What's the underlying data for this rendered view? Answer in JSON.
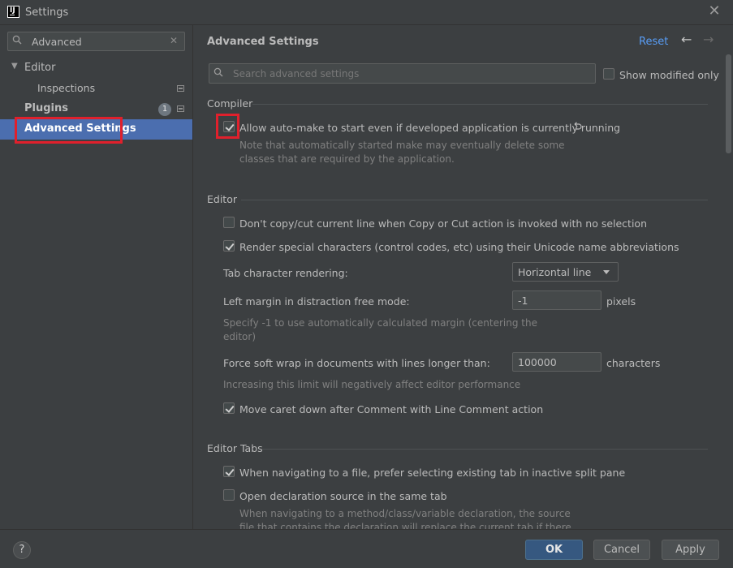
{
  "window": {
    "title": "Settings",
    "close_glyph": "✕"
  },
  "sidebar": {
    "search_value": "Advanced",
    "items": [
      {
        "label": "Editor",
        "expanded": true
      },
      {
        "label": "Inspections"
      },
      {
        "label": "Plugins",
        "badge": "1"
      },
      {
        "label": "Advanced Settings",
        "selected": true
      }
    ]
  },
  "header": {
    "title": "Advanced Settings",
    "reset": "Reset",
    "back_glyph": "←",
    "forward_glyph": "→"
  },
  "search": {
    "placeholder": "Search advanced settings",
    "show_modified_label": "Show modified only",
    "show_modified_checked": false
  },
  "compiler": {
    "section": "Compiler",
    "auto_make_label": "Allow auto-make to start even if developed application is currently running",
    "auto_make_checked": true,
    "auto_make_note_1": "Note that automatically started make may eventually delete some",
    "auto_make_note_2": "classes that are required by the application."
  },
  "editor": {
    "section": "Editor",
    "dont_copy_label": "Don't copy/cut current line when Copy or Cut action is invoked with no selection",
    "dont_copy_checked": false,
    "render_special_label": "Render special characters (control codes, etc) using their Unicode name abbreviations",
    "render_special_checked": true,
    "tab_rendering_label": "Tab character rendering:",
    "tab_rendering_value": "Horizontal line",
    "left_margin_label": "Left margin in distraction free mode:",
    "left_margin_value": "-1",
    "left_margin_unit": "pixels",
    "left_margin_note_1": "Specify -1 to use automatically calculated margin (centering the",
    "left_margin_note_2": "editor)",
    "soft_wrap_label": "Force soft wrap in documents with lines longer than:",
    "soft_wrap_value": "100000",
    "soft_wrap_unit": "characters",
    "soft_wrap_note": "Increasing this limit will negatively affect editor performance",
    "move_caret_label": "Move caret down after Comment with Line Comment action",
    "move_caret_checked": true
  },
  "editor_tabs": {
    "section": "Editor Tabs",
    "prefer_existing_label": "When navigating to a file, prefer selecting existing tab in inactive split pane",
    "prefer_existing_checked": true,
    "open_same_tab_label": "Open declaration source in the same tab",
    "open_same_tab_checked": false,
    "open_same_tab_note_1": "When navigating to a method/class/variable declaration, the source",
    "open_same_tab_note_2": "file that contains the declaration will replace the current tab if there"
  },
  "footer": {
    "help": "?",
    "ok": "OK",
    "cancel": "Cancel",
    "apply": "Apply"
  },
  "colors": {
    "accent": "#4b6eaf",
    "link": "#589df6",
    "highlight": "#e0202c",
    "background": "#3c3f41"
  }
}
